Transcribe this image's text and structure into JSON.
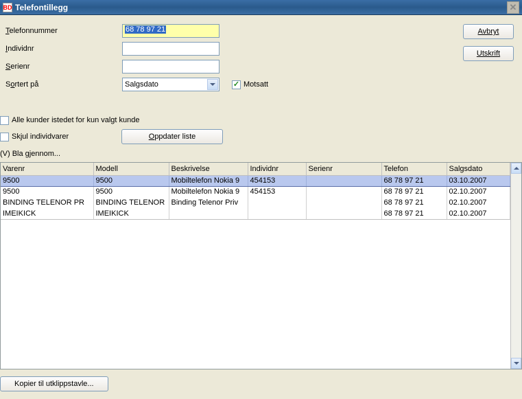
{
  "window": {
    "title": "Telefontillegg",
    "icon": "BD"
  },
  "side": {
    "avbryt": "Avbryt",
    "utskrift": "Utskrift"
  },
  "form": {
    "telefonnummer_label": "Telefonnummer",
    "telefonnummer_value": "68 78 97 21",
    "individnr_label": "Individnr",
    "individnr_value": "",
    "serienr_label": "Serienr",
    "serienr_value": "",
    "sortert_label": "Sortert på",
    "sortert_value": "Salgsdato",
    "motsatt_label": "Motsatt",
    "alle_kunder_label": "Alle kunder istedet for kun valgt kunde",
    "skjul_label": "Skjul individvarer",
    "oppdater_btn": "Oppdater liste",
    "bla_label": "(V) Bla gjennom..."
  },
  "table": {
    "headers": [
      "Varenr",
      "Modell",
      "Beskrivelse",
      "Individnr",
      "Serienr",
      "Telefon",
      "Salgsdato"
    ],
    "rows": [
      {
        "varenr": "9500",
        "modell": "9500",
        "beskrivelse": "Mobiltelefon Nokia 9",
        "individnr": "454153",
        "serienr": "",
        "telefon": "68 78 97 21",
        "salgsdato": "03.10.2007"
      },
      {
        "varenr": "9500",
        "modell": "9500",
        "beskrivelse": "Mobiltelefon Nokia 9",
        "individnr": "454153",
        "serienr": "",
        "telefon": "68 78 97 21",
        "salgsdato": "02.10.2007"
      },
      {
        "varenr": "BINDING TELENOR PR",
        "modell": "BINDING TELENOR",
        "beskrivelse": "Binding Telenor Priv",
        "individnr": "",
        "serienr": "",
        "telefon": "68 78 97 21",
        "salgsdato": "02.10.2007"
      },
      {
        "varenr": "IMEIKICK",
        "modell": "IMEIKICK",
        "beskrivelse": "",
        "individnr": "",
        "serienr": "",
        "telefon": "68 78 97 21",
        "salgsdato": "02.10.2007"
      }
    ]
  },
  "bottom": {
    "kopier": "Kopier til utklippstavle..."
  }
}
